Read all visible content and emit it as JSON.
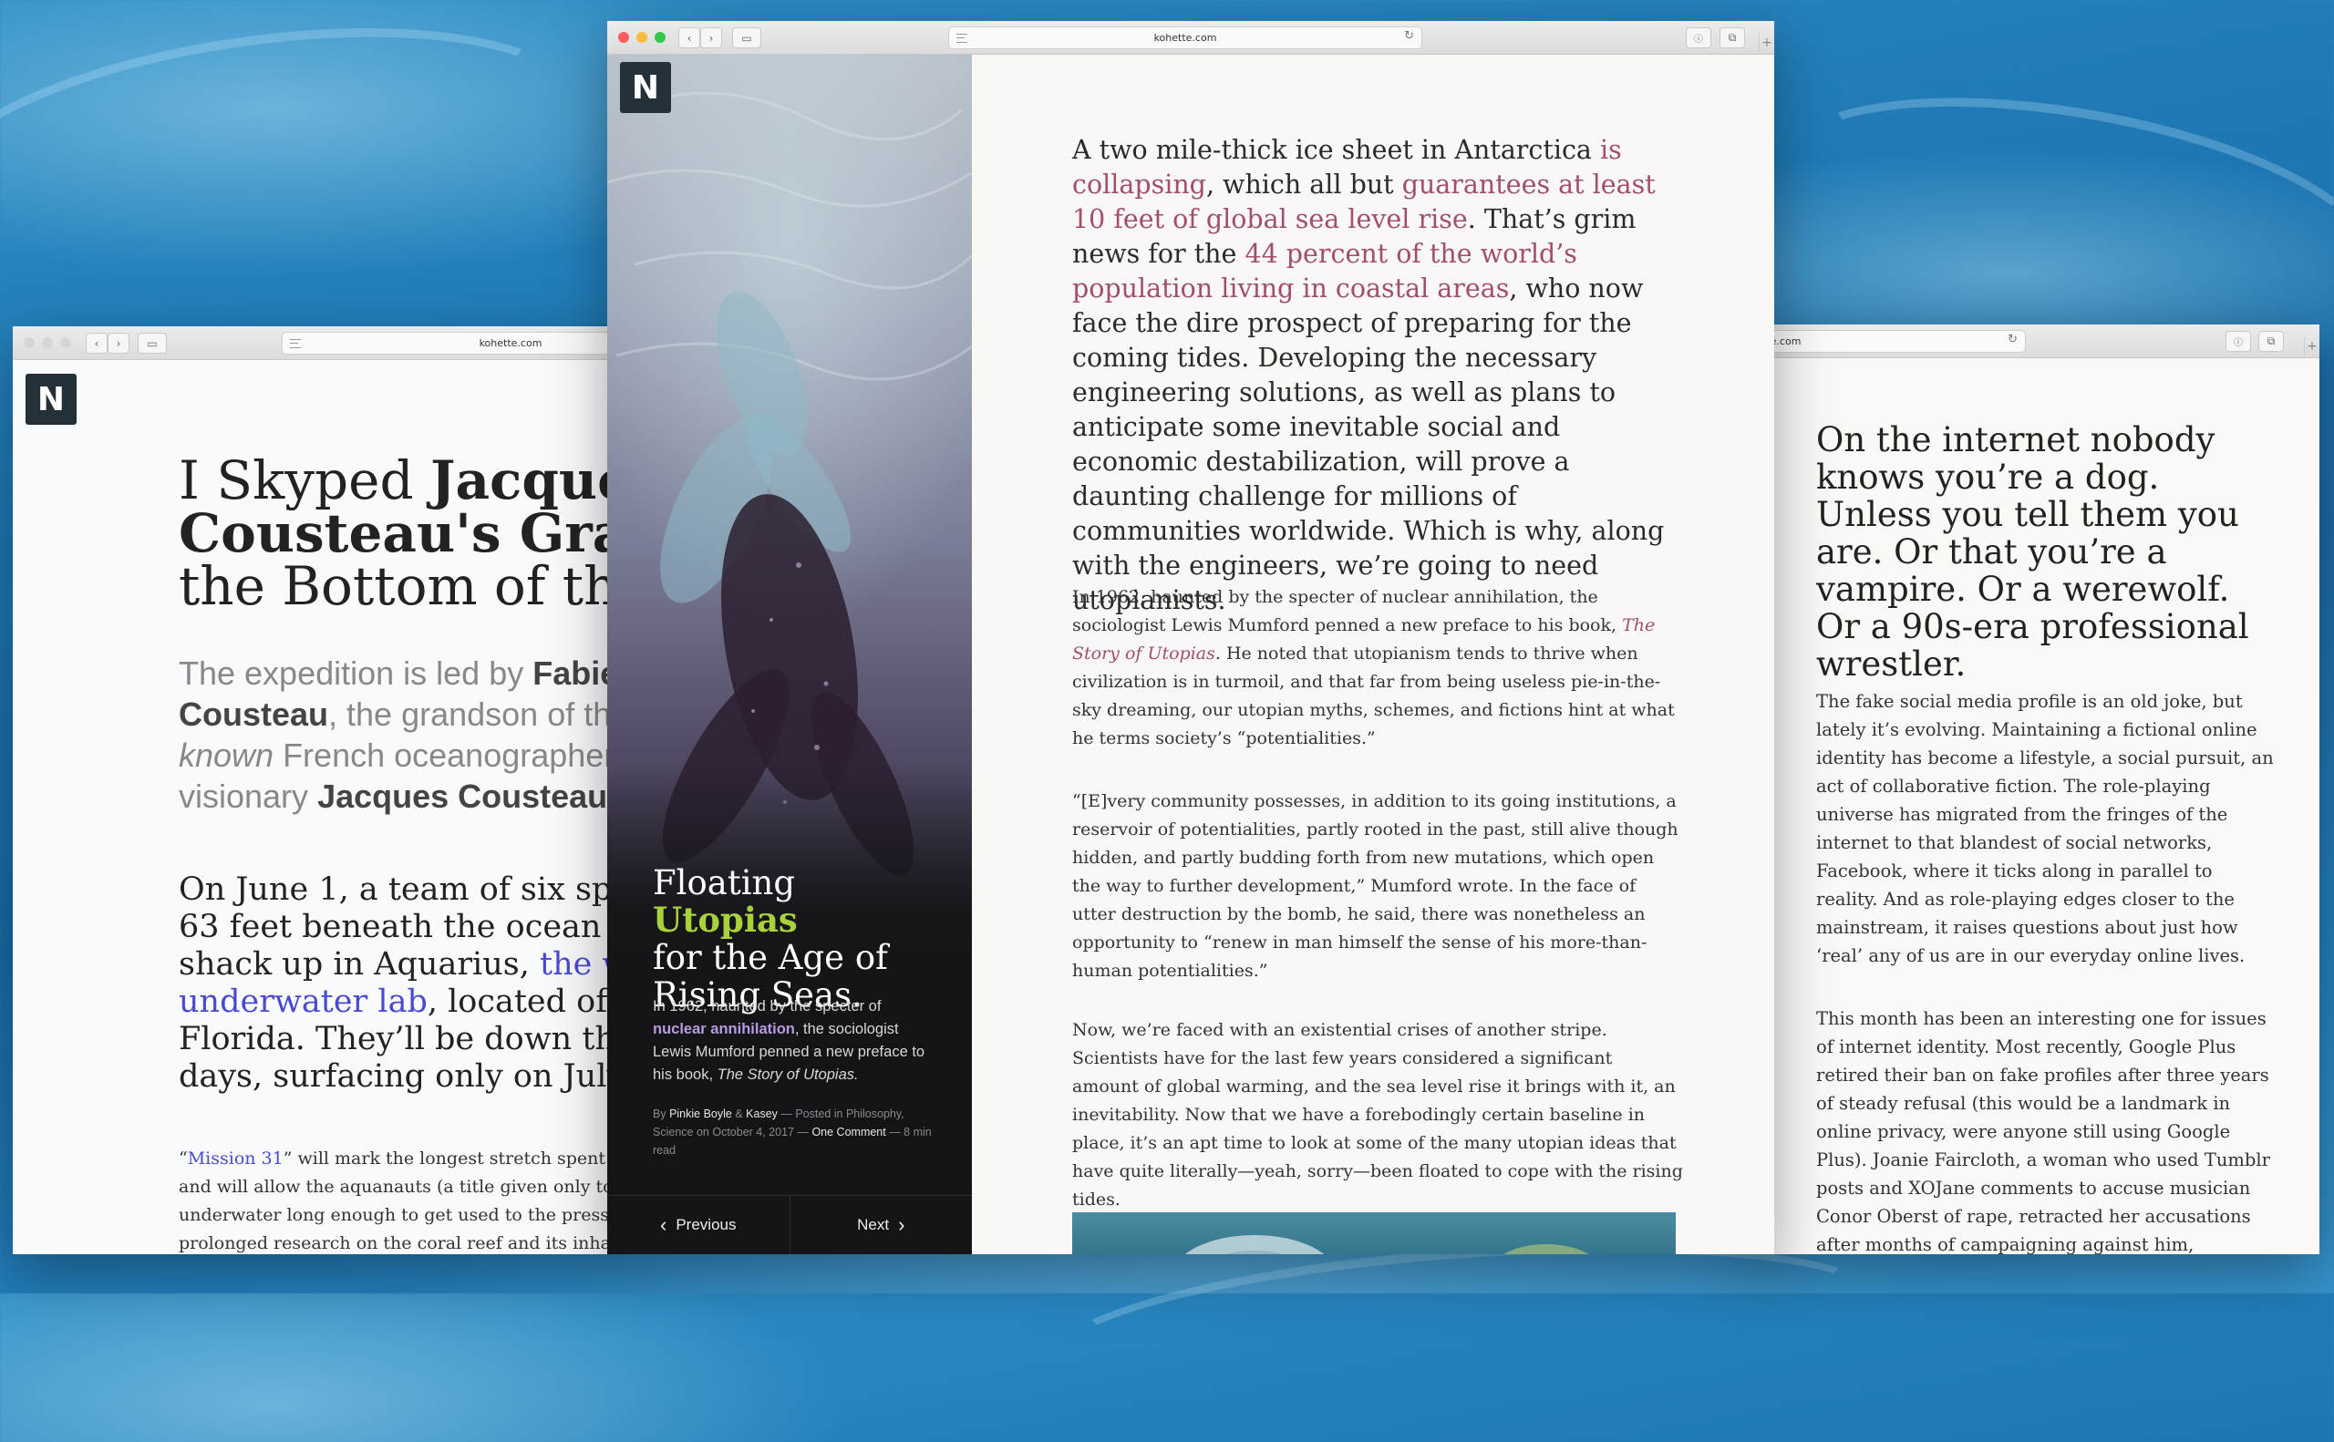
{
  "desktop": {
    "background": "ocean-aerial"
  },
  "windows": {
    "left": {
      "url": "kohette.com",
      "logo": "N",
      "title_light": "I Skyped ",
      "title_bold_1": "Jacques",
      "title_line2": "Cousteau's Grand",
      "title_line3": "the Bottom of the",
      "intro": {
        "t1": "The expedition is led by ",
        "b1": "Fabie",
        "b2": "Cousteau",
        "t2": ", the grandson of th",
        "i1": "known",
        "t3": " French oceanographer",
        "t4": "visionary ",
        "b3": "Jacques Cousteau",
        "t5": "."
      },
      "lede": {
        "l1": "On June 1, a team of six spla",
        "l2": "63 feet beneath the ocean su",
        "l3a": "shack up in Aquarius, ",
        "l3link": "the wo",
        "l4link": "underwater lab",
        "l4b": ", located off t",
        "l5": "Florida. They’ll be down the",
        "l6": "days, surfacing only on July"
      },
      "body": {
        "q1": "“",
        "link": "Mission 31",
        "l1": "” will mark the longest stretch spent in",
        "l2": "and will allow the aquanauts (a title given only to t",
        "l3": "underwater long enough to get used to the pressur",
        "l4": "prolonged research on the coral reef and its inhabi"
      }
    },
    "center": {
      "url": "kohette.com",
      "logo": "N",
      "sidebar": {
        "title_a": "Floating ",
        "title_accent": "Utopias",
        "title_b": "for the Age of",
        "title_c": "Rising Seas.",
        "excerpt_a": "In 1962, haunted by the specter of ",
        "excerpt_link": "nuclear annihilation",
        "excerpt_b": ", the sociologist Lewis Mumford penned a new preface to his book, ",
        "excerpt_italic": "The Story of Utopias.",
        "meta_by": "By ",
        "author1": "Pinkie Boyle",
        "meta_amp": " & ",
        "author2": "Kasey",
        "meta_posted": " — Posted in ",
        "categories": "Philosophy, Science",
        "meta_on": " on ",
        "date": "October 4, 2017",
        "meta_dash": " — ",
        "comments": "One Comment",
        "meta_read": " — 8 min read",
        "prev": "Previous",
        "next": "Next",
        "prev_glyph": "‹",
        "next_glyph": "›"
      },
      "article": {
        "lead_a": "A two mile-thick ice sheet in Antarctica ",
        "lead_link1": "is collapsing",
        "lead_b": ", which all but ",
        "lead_link2": "guarantees at least 10 feet of global sea level rise",
        "lead_c": ". That’s grim news for the ",
        "lead_link3": "44 percent of the world’s population living in coastal areas",
        "lead_d": ", who now face the dire prospect of preparing for the coming tides. Developing the necessary engineering solutions, as well as plans to anticipate some inevitable social and economic destabilization, will prove a daunting challenge for millions of communities worldwide. Which is why, along with the engineers, we’re going to need utopianists.",
        "p1_a": "In 1962, haunted by the specter of nuclear annihilation, the sociologist Lewis Mumford penned a new preface to his book, ",
        "p1_link": "The Story of Utopias",
        "p1_b": ". He noted that utopianism tends to thrive when civilization is in turmoil, and that far from being useless pie-in-the-sky dreaming, our utopian myths, schemes, and fictions hint at what he terms society’s “potentialities.”",
        "p2": "“[E]very community possesses, in addition to its going institutions, a reservoir of potentialities, partly rooted in the past, still alive though hidden, and partly budding forth from new mutations, which open the way to further development,” Mumford wrote. In the face of utter destruction by the bomb, he said, there was nonetheless an opportunity to “renew in man himself the sense of his more-than-human potentialities.”",
        "p3": "Now, we’re faced with an existential crises of another stripe. Scientists have for the last few years considered a significant amount of global warming, and the sea level rise it brings with it, an inevitability. Now that we have a forebodingly certain baseline in place, it’s an apt time to look at some of the many utopian ideas that have quite literally—yeah, sorry—been floated to cope with the rising tides."
      }
    },
    "right": {
      "url": "kohette.com",
      "big": "On the internet nobody knows you’re a dog. Unless you tell them you are. Or that you’re a vampire. Or a werewolf. Or a 90s-era professional wrestler.",
      "p1": "The fake social media profile is an old joke, but lately it’s evolving. Maintaining a fictional online identity has become a lifestyle, a social pursuit, an act of collaborative fiction. The role-playing universe has migrated from the fringes of the internet to that blandest of social networks, Facebook, where it ticks along in parallel to reality. And as role-playing edges closer to the mainstream, it raises questions about just how ‘real’ any of us are in our everyday online lives.",
      "p2": "This month has been an interesting one for issues of internet identity. Most recently, Google Plus retired their ban on fake profiles after three years of steady refusal (this would be a landmark in online privacy, were anyone still using Google Plus). Joanie Faircloth, a woman who used Tumblr posts and XOJane comments to accuse musician Conor Oberst of rape, retracted her accusations after months of campaigning against him,"
    }
  },
  "colors": {
    "link_center": "#a14f6a",
    "link_left": "#4a4ad0",
    "accent_title": "#a8d23a",
    "traffic_close": "#fc605c",
    "traffic_min": "#fdbc40",
    "traffic_max": "#34c84a"
  },
  "icons": [
    "back-icon",
    "forward-icon",
    "sidebar-icon",
    "reader-icon",
    "reload-icon",
    "info-icon",
    "tabs-icon",
    "new-tab-icon"
  ]
}
